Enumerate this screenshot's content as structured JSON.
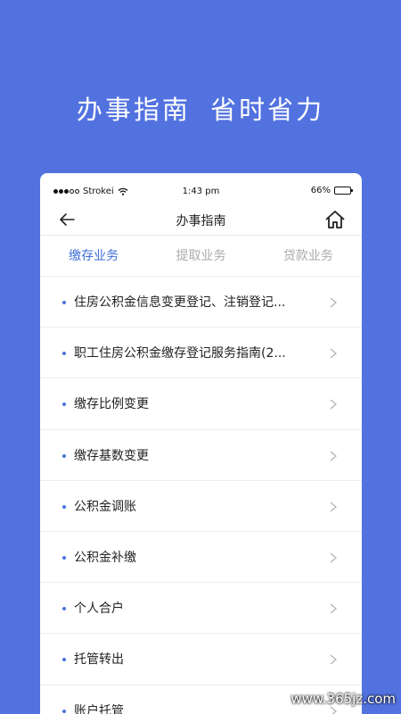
{
  "promo": {
    "title": "办事指南  省时省力"
  },
  "status_bar": {
    "carrier": "Strokei",
    "time": "1:43 pm",
    "battery": "66%",
    "battery_level": 0.66
  },
  "nav": {
    "title": "办事指南",
    "back_icon": "back-arrow-icon",
    "home_icon": "home-icon"
  },
  "tabs": [
    {
      "label": "缴存业务",
      "active": true
    },
    {
      "label": "提取业务",
      "active": false
    },
    {
      "label": "贷款业务",
      "active": false
    }
  ],
  "items": [
    {
      "label": "住房公积金信息变更登记、注销登记..."
    },
    {
      "label": "职工住房公积金缴存登记服务指南(2..."
    },
    {
      "label": "缴存比例变更"
    },
    {
      "label": "缴存基数变更"
    },
    {
      "label": "公积金调账"
    },
    {
      "label": "公积金补缴"
    },
    {
      "label": "个人合户"
    },
    {
      "label": "托管转出"
    },
    {
      "label": "账户托管"
    }
  ],
  "watermark": {
    "text": "www.365jz.com"
  },
  "colors": {
    "background": "#5272e0",
    "accent": "#3f6fd8",
    "bullet": "#4a74dc"
  }
}
